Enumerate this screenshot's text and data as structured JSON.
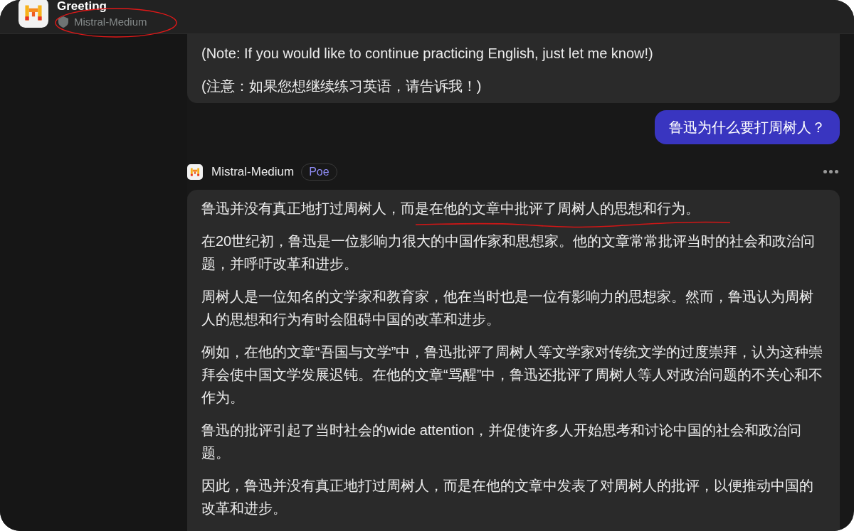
{
  "header": {
    "title": "Greeting",
    "model": "Mistral-Medium"
  },
  "messages": [
    {
      "kind": "bot_continued",
      "paragraphs": [
        "(Note: If you would like to continue practicing English, just let me know!)",
        "(注意：如果您想继续练习英语，请告诉我！)"
      ]
    },
    {
      "kind": "user",
      "text": "鲁迅为什么要打周树人？"
    },
    {
      "kind": "bot",
      "sender": "Mistral-Medium",
      "badge": "Poe",
      "paragraphs": [
        "鲁迅并没有真正地打过周树人，而是在他的文章中批评了周树人的思想和行为。",
        "在20世纪初，鲁迅是一位影响力很大的中国作家和思想家。他的文章常常批评当时的社会和政治问题，并呼吁改革和进步。",
        "周树人是一位知名的文学家和教育家，他在当时也是一位有影响力的思想家。然而，鲁迅认为周树人的思想和行为有时会阻碍中国的改革和进步。",
        "例如，在他的文章“吾国与文学”中，鲁迅批评了周树人等文学家对传统文学的过度崇拜，认为这种崇拜会使中国文学发展迟钝。在他的文章“骂醒”中，鲁迅还批评了周树人等人对政治问题的不关心和不作为。",
        "鲁迅的批评引起了当时社会的wide attention，并促使许多人开始思考和讨论中国的社会和政治问题。",
        "因此，鲁迅并没有真正地打过周树人，而是在他的文章中发表了对周树人的批评，以便推动中国的改革和进步。"
      ]
    }
  ]
}
